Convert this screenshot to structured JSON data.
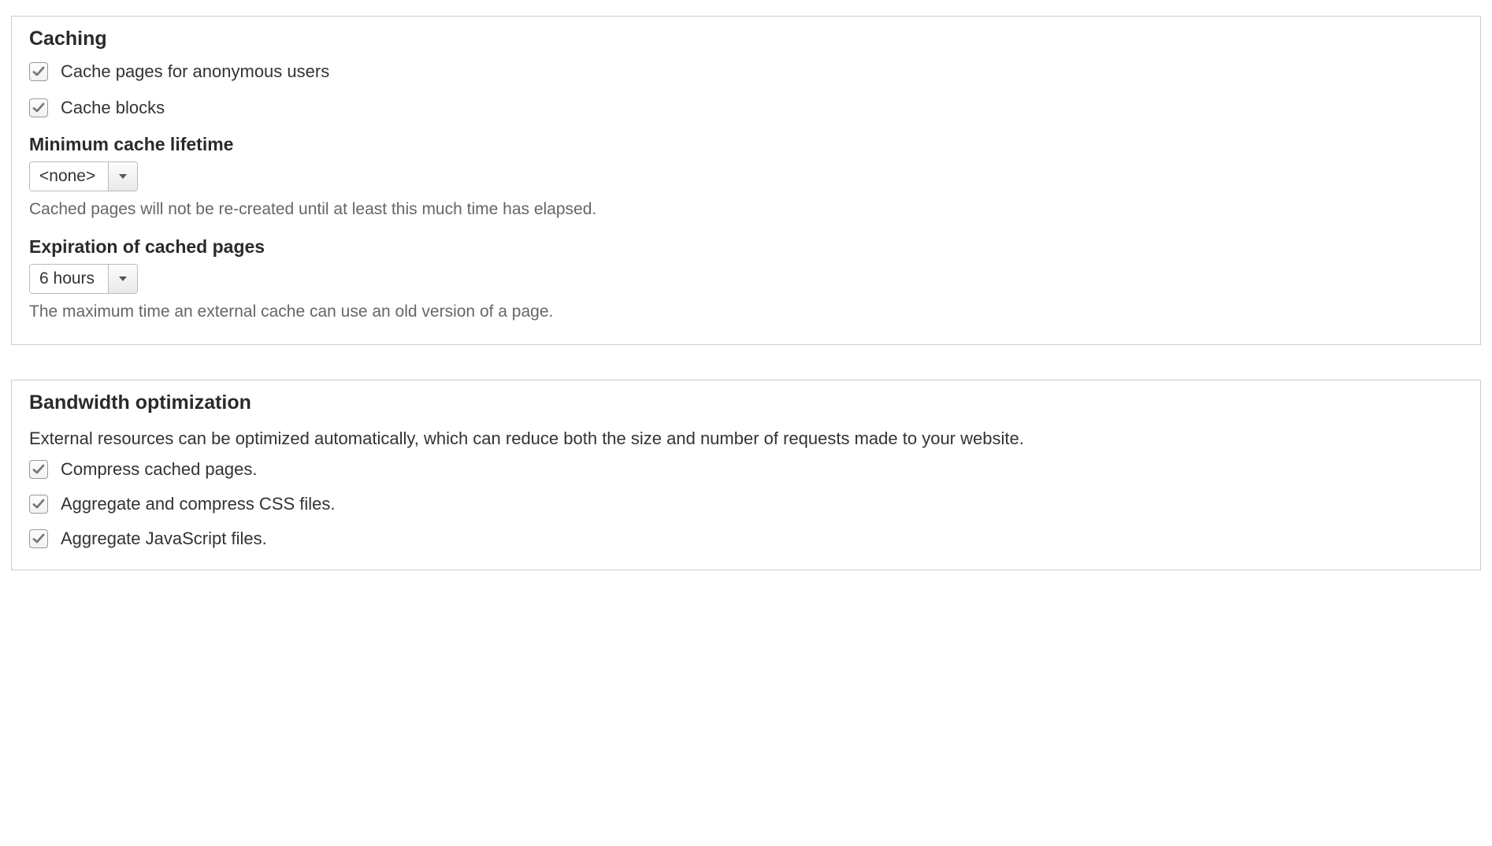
{
  "caching": {
    "legend": "Caching",
    "cache_pages_label": "Cache pages for anonymous users",
    "cache_pages_checked": true,
    "cache_blocks_label": "Cache blocks",
    "cache_blocks_checked": true,
    "min_lifetime_label": "Minimum cache lifetime",
    "min_lifetime_value": "<none>",
    "min_lifetime_desc": "Cached pages will not be re-created until at least this much time has elapsed.",
    "expiration_label": "Expiration of cached pages",
    "expiration_value": "6 hours",
    "expiration_desc": "The maximum time an external cache can use an old version of a page."
  },
  "bandwidth": {
    "legend": "Bandwidth optimization",
    "description": "External resources can be optimized automatically, which can reduce both the size and number of requests made to your website.",
    "compress_label": "Compress cached pages.",
    "compress_checked": true,
    "aggregate_css_label": "Aggregate and compress CSS files.",
    "aggregate_css_checked": true,
    "aggregate_js_label": "Aggregate JavaScript files.",
    "aggregate_js_checked": true
  }
}
